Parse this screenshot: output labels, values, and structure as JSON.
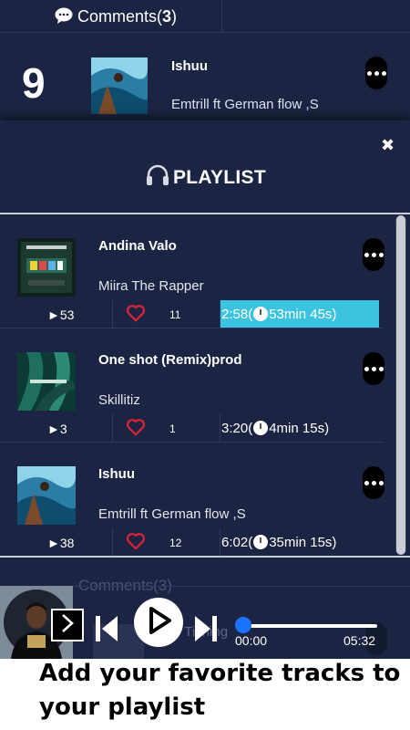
{
  "background": {
    "comments_prefix": "Comments(",
    "comments_count": "3",
    "comments_suffix": ")",
    "rank": "9",
    "title": "Ishuu",
    "artist": "Emtrill ft German flow ,Sl"
  },
  "playlist": {
    "close_icon": "✖",
    "title": "PLAYLIST",
    "tracks": [
      {
        "title": "Andina Valo",
        "artist": "Miira The Rapper",
        "plays": "►53",
        "likes": "11",
        "duration": "2:58(",
        "total": "53min 45s)",
        "active": true
      },
      {
        "title": "One shot (Remix)prod by",
        "artist": "Skillitiz",
        "plays": "►3",
        "likes": "1",
        "duration": "3:20(",
        "total": "4min 15s)",
        "active": false
      },
      {
        "title": "Ishuu",
        "artist": "Emtrill ft German flow ,Sl",
        "plays": "►38",
        "likes": "12",
        "duration": "6:02(",
        "total": "35min 15s)",
        "active": false
      }
    ]
  },
  "player": {
    "under_comments": "Comments(3)",
    "under_title": "o Tiching",
    "elapsed": "00:00",
    "total": "05:32",
    "progress": 0
  },
  "caption": "Add your favorite tracks  to your playlist",
  "colors": {
    "background": "#1b2442",
    "active_duration": "#3cc3e0",
    "heart": "#e0223b",
    "seek_knob": "#1a73ff"
  },
  "icons": [
    "comment-icon",
    "headphones-icon",
    "close-icon",
    "more-icon",
    "heart-icon",
    "clock-icon",
    "expand-icon",
    "previous-icon",
    "play-icon",
    "next-icon"
  ]
}
